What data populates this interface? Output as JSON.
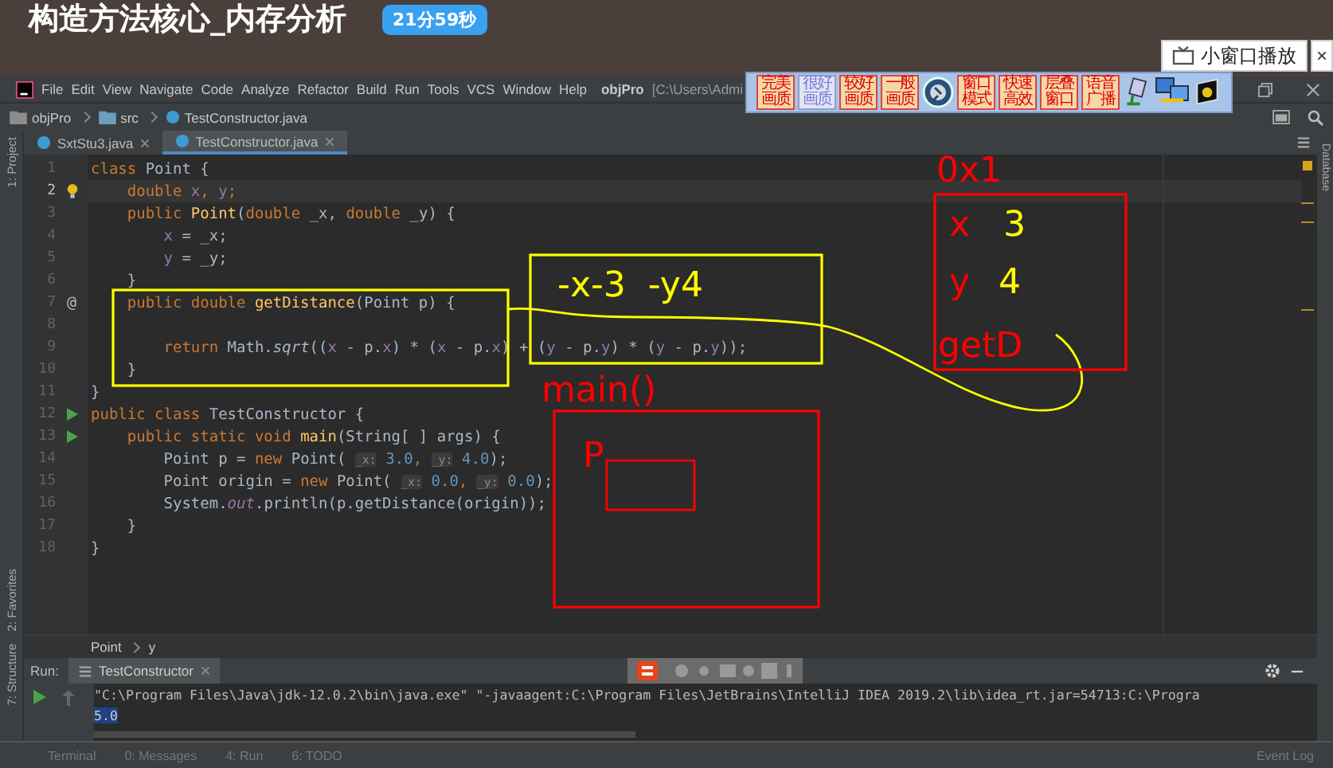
{
  "header": {
    "title": "构造方法核心_内存分析",
    "timer": "21分59秒",
    "pip_button": "小窗口播放",
    "close": "×"
  },
  "menu": {
    "items": [
      "File",
      "Edit",
      "View",
      "Navigate",
      "Code",
      "Analyze",
      "Refactor",
      "Build",
      "Run",
      "Tools",
      "VCS",
      "Window",
      "Help"
    ],
    "project": "objPro",
    "path": "[C:\\Users\\Admi"
  },
  "capture_toolbar": {
    "buttons": [
      {
        "lines": [
          "完美",
          "画质"
        ],
        "selected": false
      },
      {
        "lines": [
          "很好",
          "画质"
        ],
        "selected": true
      },
      {
        "lines": [
          "较好",
          "画质"
        ],
        "selected": false
      },
      {
        "lines": [
          "一般",
          "画质"
        ],
        "selected": false
      },
      {
        "lines": [
          "窗口",
          "模式"
        ],
        "selected": false
      },
      {
        "lines": [
          "快速",
          "高效"
        ],
        "selected": false
      },
      {
        "lines": [
          "层叠",
          "窗口"
        ],
        "selected": false
      },
      {
        "lines": [
          "语音",
          "广播"
        ],
        "selected": false
      }
    ]
  },
  "breadcrumb": [
    "objPro",
    "src",
    "TestConstructor.java"
  ],
  "tabs": [
    {
      "label": "SxtStu3.java",
      "selected": false
    },
    {
      "label": "TestConstructor.java",
      "selected": true
    }
  ],
  "side_tools": {
    "left_top": "1: Project",
    "left_middle": "2: Favorites",
    "left_bottom": "7: Structure",
    "right": "Database"
  },
  "editor": {
    "lines": [
      {
        "number": "1",
        "current": false,
        "tokens": [
          {
            "kind": "kw",
            "text": "class "
          },
          {
            "kind": "pl",
            "text": "Point {"
          }
        ]
      },
      {
        "number": "2",
        "current": true,
        "kind": "bulb",
        "tokens": [
          {
            "kind": "kw",
            "text": "    double "
          },
          {
            "kind": "fd",
            "text": "x"
          },
          {
            "kind": "kw",
            "text": ", "
          },
          {
            "kind": "fd",
            "text": "y"
          },
          {
            "kind": "kw",
            "text": ";"
          }
        ]
      },
      {
        "number": "3",
        "current": false,
        "tokens": [
          {
            "kind": "kw",
            "text": "    public "
          },
          {
            "kind": "md",
            "text": "Point"
          },
          {
            "kind": "pl",
            "text": "("
          },
          {
            "kind": "kw",
            "text": "double "
          },
          {
            "kind": "pl",
            "text": "_x, "
          },
          {
            "kind": "kw",
            "text": "double "
          },
          {
            "kind": "pl",
            "text": "_y) {"
          }
        ]
      },
      {
        "number": "4",
        "current": false,
        "tokens": [
          {
            "kind": "fd",
            "text": "        x"
          },
          {
            "kind": "pl",
            "text": " = _x;"
          }
        ]
      },
      {
        "number": "5",
        "current": false,
        "tokens": [
          {
            "kind": "fd",
            "text": "        y"
          },
          {
            "kind": "pl",
            "text": " = _y;"
          }
        ]
      },
      {
        "number": "6",
        "current": false,
        "tokens": [
          {
            "kind": "pl",
            "text": "    }"
          }
        ]
      },
      {
        "number": "7",
        "current": false,
        "gutter_text": "@",
        "tokens": [
          {
            "kind": "kw",
            "text": "    public double "
          },
          {
            "kind": "md",
            "text": "getDistance"
          },
          {
            "kind": "pl",
            "text": "(Point p) {"
          }
        ]
      },
      {
        "number": "8",
        "current": false
      },
      {
        "number": "9",
        "current": false,
        "tokens": [
          {
            "kind": "kw",
            "text": "        return "
          },
          {
            "kind": "pl",
            "text": "Math."
          },
          {
            "kind": "it",
            "text": "sqrt"
          },
          {
            "kind": "pl",
            "text": "(("
          },
          {
            "kind": "fd",
            "text": "x"
          },
          {
            "kind": "pl",
            "text": " - p."
          },
          {
            "kind": "fd",
            "text": "x"
          },
          {
            "kind": "pl",
            "text": ") * ("
          },
          {
            "kind": "fd",
            "text": "x"
          },
          {
            "kind": "pl",
            "text": " - p."
          },
          {
            "kind": "fd",
            "text": "x"
          },
          {
            "kind": "pl",
            "text": ") + ("
          },
          {
            "kind": "fd",
            "text": "y"
          },
          {
            "kind": "pl",
            "text": " - p."
          },
          {
            "kind": "fd",
            "text": "y"
          },
          {
            "kind": "pl",
            "text": ") * ("
          },
          {
            "kind": "fd",
            "text": "y"
          },
          {
            "kind": "pl",
            "text": " - p."
          },
          {
            "kind": "fd",
            "text": "y"
          },
          {
            "kind": "pl",
            "text": "));"
          }
        ]
      },
      {
        "number": "10",
        "current": false,
        "tokens": [
          {
            "kind": "pl",
            "text": "    }"
          }
        ]
      },
      {
        "number": "11",
        "current": false,
        "tokens": [
          {
            "kind": "pl",
            "text": "}"
          }
        ]
      },
      {
        "number": "12",
        "current": false,
        "kind": "run",
        "tokens": [
          {
            "kind": "kw",
            "text": "public class "
          },
          {
            "kind": "pl",
            "text": "TestConstructor {"
          }
        ]
      },
      {
        "number": "13",
        "current": false,
        "kind": "run",
        "tokens": [
          {
            "kind": "kw",
            "text": "    public static void "
          },
          {
            "kind": "md",
            "text": "main"
          },
          {
            "kind": "pl",
            "text": "(String[ ] args) {"
          }
        ]
      },
      {
        "number": "14",
        "current": false,
        "tokens": [
          {
            "kind": "pl",
            "text": "        Point p = "
          },
          {
            "kind": "kw",
            "text": "new "
          },
          {
            "kind": "pl",
            "text": "Point( "
          },
          {
            "kind": "hint",
            "text": "_x:"
          },
          {
            "kind": "nm",
            "text": " 3.0"
          },
          {
            "kind": "kw",
            "text": ", "
          },
          {
            "kind": "hint",
            "text": "_y:"
          },
          {
            "kind": "nm",
            "text": " 4.0"
          },
          {
            "kind": "pl",
            "text": ");"
          }
        ]
      },
      {
        "number": "15",
        "current": false,
        "tokens": [
          {
            "kind": "pl",
            "text": "        Point origin = "
          },
          {
            "kind": "kw",
            "text": "new "
          },
          {
            "kind": "pl",
            "text": "Point( "
          },
          {
            "kind": "hint",
            "text": "_x:"
          },
          {
            "kind": "nm",
            "text": " 0.0"
          },
          {
            "kind": "kw",
            "text": ", "
          },
          {
            "kind": "hint",
            "text": "_y:"
          },
          {
            "kind": "nm",
            "text": " 0.0"
          },
          {
            "kind": "pl",
            "text": ");"
          }
        ]
      },
      {
        "number": "16",
        "current": false,
        "tokens": [
          {
            "kind": "pl",
            "text": "        System."
          },
          {
            "kind": "st",
            "text": "out"
          },
          {
            "kind": "pl",
            "text": ".println(p.getDistance(origin));"
          }
        ]
      },
      {
        "number": "17",
        "current": false,
        "tokens": [
          {
            "kind": "pl",
            "text": "    }"
          }
        ]
      },
      {
        "number": "18",
        "current": false,
        "tokens": [
          {
            "kind": "pl",
            "text": "}"
          }
        ]
      }
    ]
  },
  "annotations": [
    {
      "text": "-x-3  -y4",
      "color": "#ffff00"
    },
    {
      "text": "main()",
      "color": "#ff0000"
    },
    {
      "text": "P",
      "color": "#ff0000"
    },
    {
      "text": "0x1",
      "color": "#ff0000"
    },
    {
      "text": "x",
      "color": "#ff0000"
    },
    {
      "text": "3",
      "color": "#ffff00"
    },
    {
      "text": "y",
      "color": "#ff0000"
    },
    {
      "text": "4",
      "color": "#ffff00"
    },
    {
      "text": "getD",
      "color": "#ff0000"
    }
  ],
  "structure_bar": [
    "Point",
    "y"
  ],
  "run_panel": {
    "label": "Run:",
    "tab": "TestConstructor",
    "output": [
      {
        "text": "\"C:\\Program Files\\Java\\jdk-12.0.2\\bin\\java.exe\" \"-javaagent:C:\\Program Files\\JetBrains\\IntelliJ IDEA 2019.2\\lib\\idea_rt.jar=54713:C:\\Progra",
        "selected": false
      },
      {
        "text": "5.0",
        "selected": true
      }
    ]
  },
  "status_bar": {
    "items": [
      "Terminal",
      "0: Messages",
      "4: Run",
      "6: TODO"
    ],
    "event_log": "Event Log"
  }
}
